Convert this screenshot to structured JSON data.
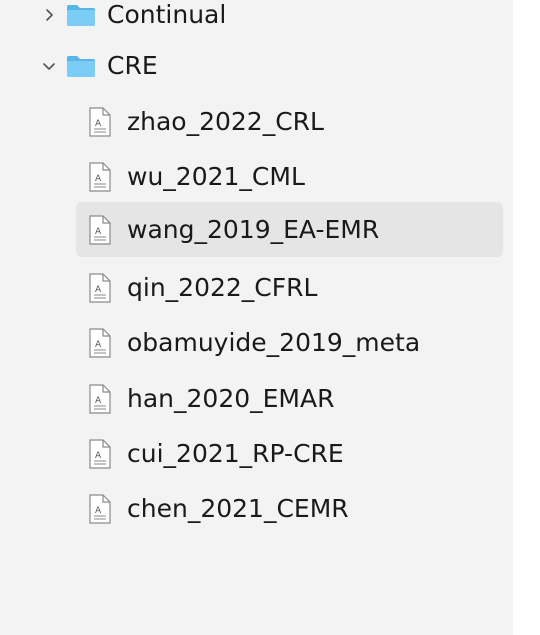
{
  "folders": [
    {
      "label": "Continual",
      "expanded": false
    },
    {
      "label": "CRE",
      "expanded": true
    }
  ],
  "files": [
    {
      "label": "zhao_2022_CRL",
      "selected": false
    },
    {
      "label": "wu_2021_CML",
      "selected": false
    },
    {
      "label": "wang_2019_EA-EMR",
      "selected": true
    },
    {
      "label": "qin_2022_CFRL",
      "selected": false
    },
    {
      "label": "obamuyide_2019_meta",
      "selected": false
    },
    {
      "label": "han_2020_EMAR",
      "selected": false
    },
    {
      "label": "cui_2021_RP-CRE",
      "selected": false
    },
    {
      "label": "chen_2021_CEMR",
      "selected": false
    }
  ],
  "colors": {
    "pane_background": "#f3f3f3",
    "selected_row": "#e5e5e5",
    "folder_icon": "#6cc4f2",
    "text": "#1a1a1a"
  },
  "icons": {
    "folder": "folder-icon",
    "file": "document-icon",
    "collapsed": "chevron-right-icon",
    "expanded": "chevron-down-icon"
  }
}
